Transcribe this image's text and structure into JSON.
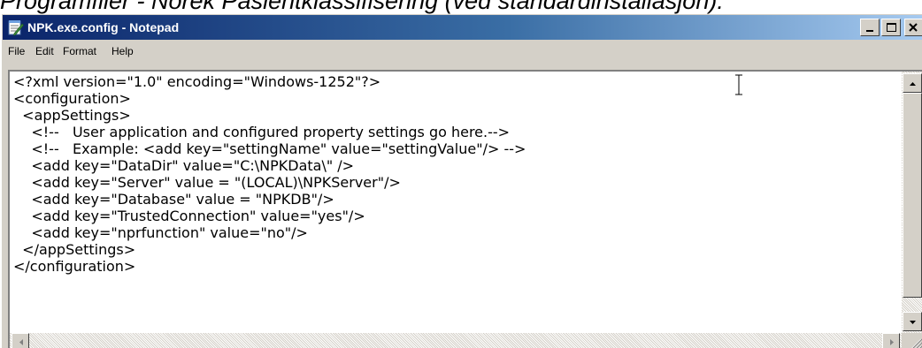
{
  "caption": {
    "text": "Programfiler - Norek Pasientklassifisering (ved standardinstallasjon):"
  },
  "window": {
    "title": "NPK.exe.config - Notepad",
    "icons": {
      "app": "notepad-icon",
      "minimize": "minimize-icon",
      "maximize": "maximize-icon",
      "close": "close-icon"
    }
  },
  "menu": {
    "items": [
      {
        "label": "File"
      },
      {
        "label": "Edit"
      },
      {
        "label": "Format"
      },
      {
        "label": "Help"
      }
    ]
  },
  "editor": {
    "lines": [
      "<?xml version=\"1.0\" encoding=\"Windows-1252\"?>",
      "<configuration>",
      "  <appSettings>",
      "    <!--   User application and configured property settings go here.-->",
      "    <!--   Example: <add key=\"settingName\" value=\"settingValue\"/> -->",
      "    <add key=\"DataDir\" value=\"C:\\NPKData\\\" />",
      "    <add key=\"Server\" value = \"(LOCAL)\\NPKServer\"/>",
      "    <add key=\"Database\" value = \"NPKDB\"/>",
      "    <add key=\"TrustedConnection\" value=\"yes\"/>",
      "    <add key=\"nprfunction\" value=\"no\"/>",
      "  </appSettings>",
      "</configuration>"
    ],
    "cursor_icon": "i-beam-cursor-icon"
  },
  "scrollbars": {
    "icons": {
      "up": "arrow-up-icon",
      "down": "arrow-down-icon",
      "left": "arrow-left-icon",
      "right": "arrow-right-icon",
      "grip": "size-grip-icon"
    }
  },
  "colors": {
    "titlebar_start": "#0a246a",
    "titlebar_end": "#a6caf0",
    "chrome": "#d4d0c8",
    "editor_bg": "#ffffff"
  }
}
